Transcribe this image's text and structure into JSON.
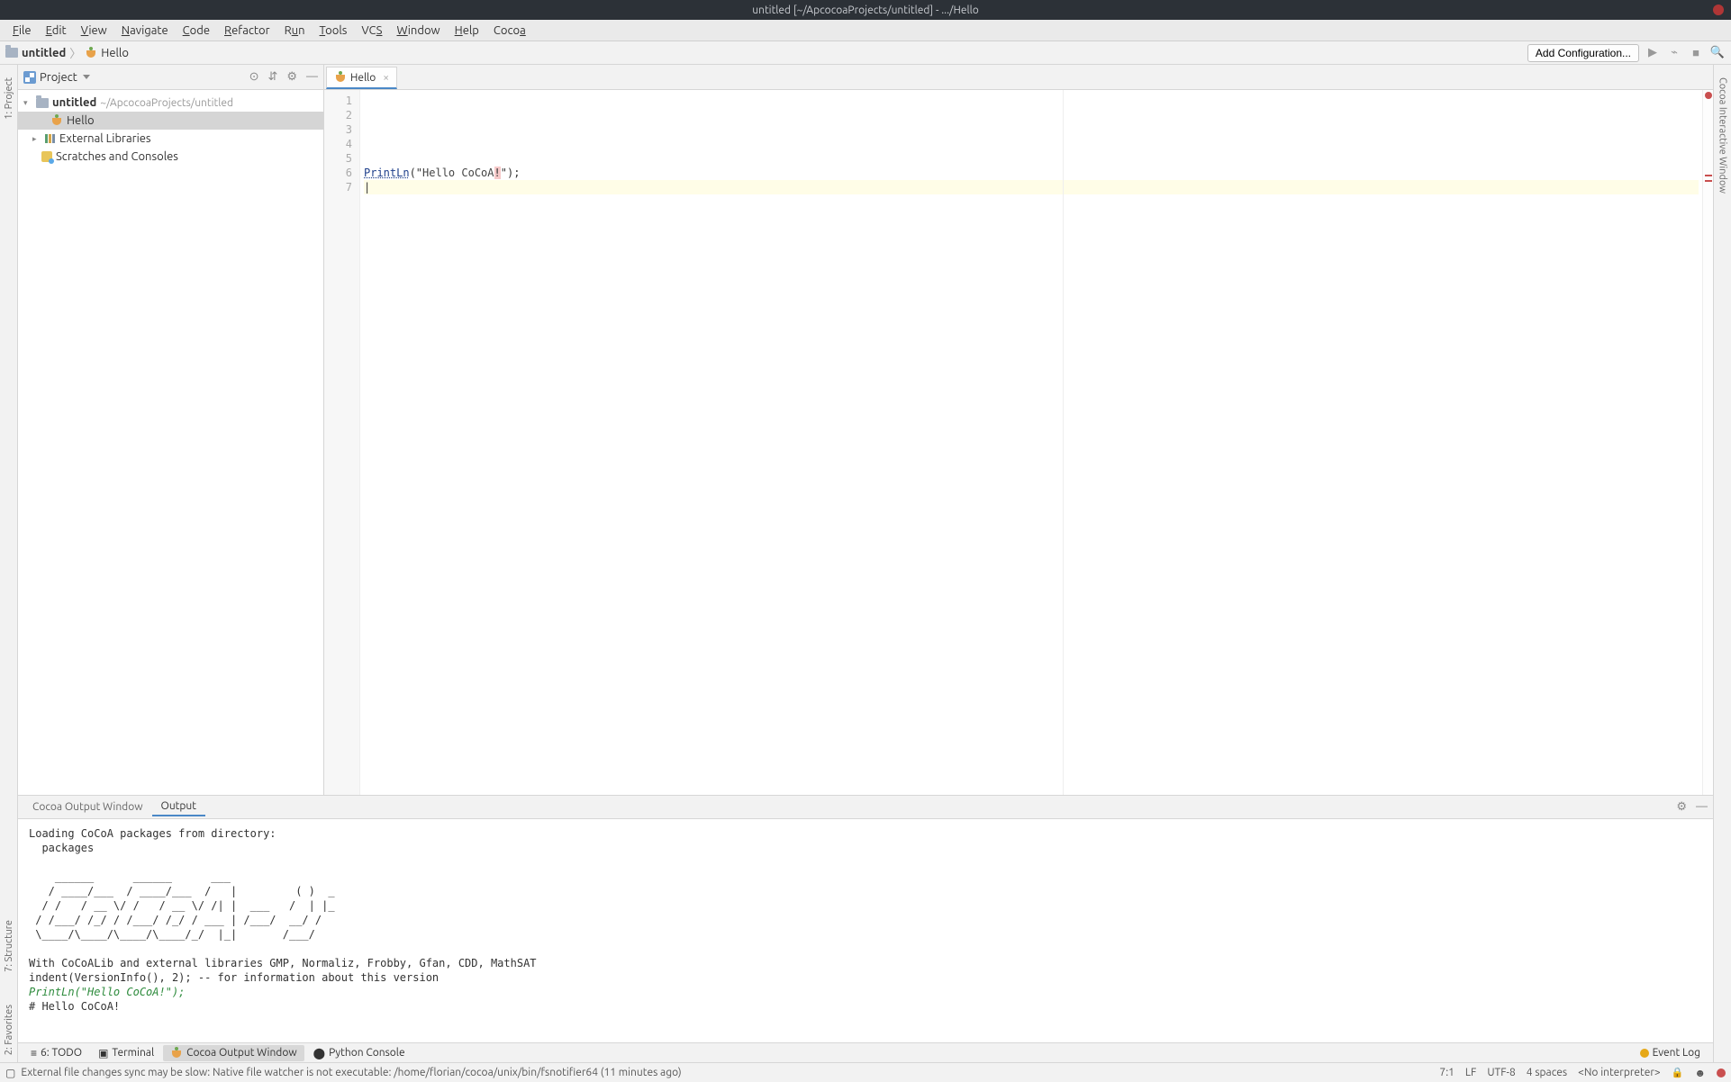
{
  "title": "untitled [~/ApcocoaProjects/untitled] - .../Hello",
  "menu": [
    "File",
    "Edit",
    "View",
    "Navigate",
    "Code",
    "Refactor",
    "Run",
    "Tools",
    "VCS",
    "Window",
    "Help",
    "Cocoa"
  ],
  "breadcrumb": {
    "project": "untitled",
    "file": "Hello"
  },
  "toolbar": {
    "add_config": "Add Configuration..."
  },
  "left_tabs": {
    "project": "1: Project",
    "structure": "7: Structure",
    "favorites": "2: Favorites"
  },
  "right_tabs": {
    "cocoa": "Cocoa Interactive Window"
  },
  "project_panel": {
    "title": "Project",
    "root": {
      "name": "untitled",
      "path": "~/ApcocoaProjects/untitled"
    },
    "file": "Hello",
    "ext_libs": "External Libraries",
    "scratches": "Scratches and Consoles"
  },
  "editor": {
    "tab": "Hello",
    "gutter": [
      "1",
      "2",
      "3",
      "4",
      "5",
      "6",
      "7"
    ],
    "code": {
      "fn": "PrintLn",
      "open": "(\"",
      "str_a": "Hello CoCoA",
      "bang": "!",
      "close": "\");"
    }
  },
  "bottom": {
    "tab1": "Cocoa Output Window",
    "tab2": "Output",
    "console_pre": "Loading CoCoA packages from directory:\n  packages\n\n    ______      ______      ___\n   / ____/___  / ____/___  /   |         ( )  _\n  / /   / __ \\/ /   / __ \\/ /| |  ___   /  | |_\n / /___/ /_/ / /___/ /_/ / ___ | /___/  __/ /\n \\____/\\____/\\____/\\____/_/  |_|       /___/\n\nWith CoCoALib and external libraries GMP, Normaliz, Frobby, Gfan, CDD, MathSAT\nindent(VersionInfo(), 2); -- for information about this version",
    "console_cmd": "PrintLn(\"Hello CoCoA!\");",
    "console_out": "# Hello CoCoA!"
  },
  "toolstrip": {
    "todo": "6: TODO",
    "terminal": "Terminal",
    "cocoa_out": "Cocoa Output Window",
    "python": "Python Console",
    "eventlog": "Event Log"
  },
  "status": {
    "msg": "External file changes sync may be slow: Native file watcher is not executable: /home/florian/cocoa/unix/bin/fsnotifier64 (11 minutes ago)",
    "pos": "7:1",
    "sep": "LF",
    "enc": "UTF-8",
    "indent": "4 spaces",
    "interp": "<No interpreter>"
  }
}
